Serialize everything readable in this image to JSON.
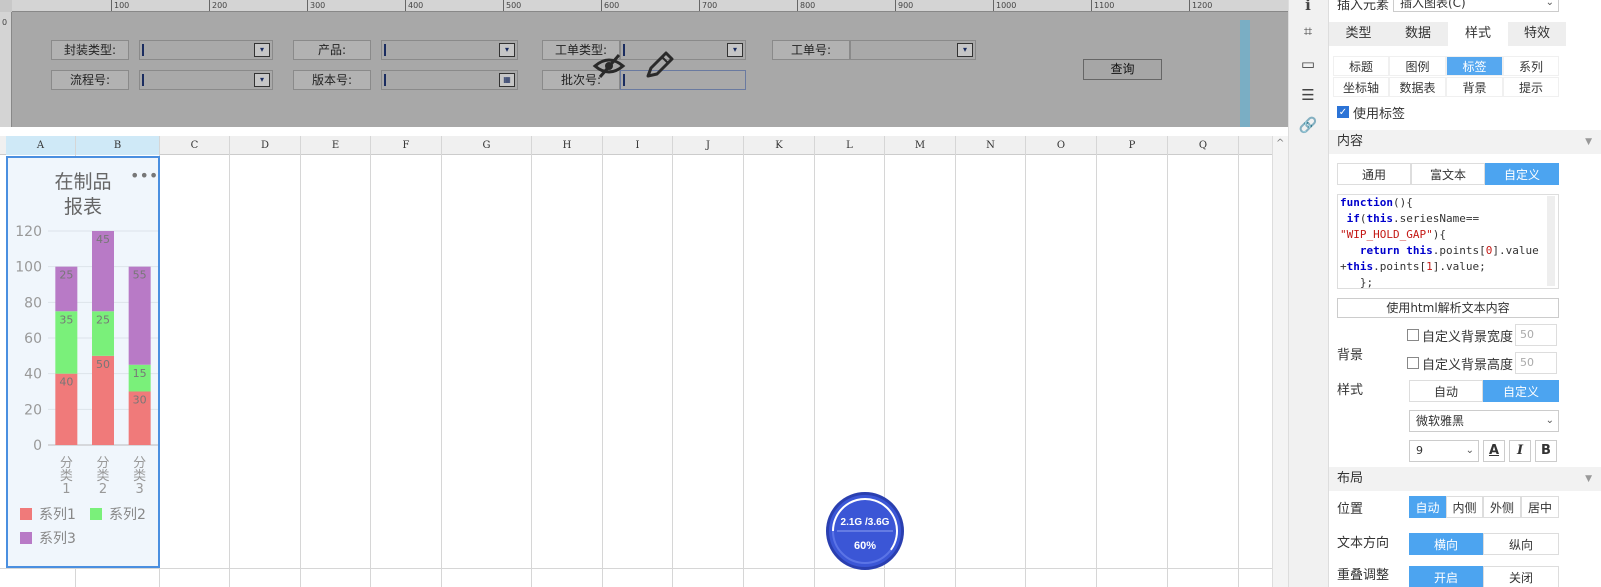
{
  "param_area": {
    "ruler_ticks": [
      "100",
      "200",
      "300",
      "400",
      "500",
      "600",
      "700",
      "800",
      "900",
      "1000",
      "1100",
      "1200"
    ],
    "left_ruler": [
      "0"
    ],
    "labels": {
      "package_type": "封装类型:",
      "product": "产品:",
      "work_order_type": "工单类型:",
      "work_order_no": "工单号:",
      "flow_no": "流程号:",
      "version_no": "版本号:",
      "batch_no": "批次号:"
    },
    "query_button": "查询",
    "dropdown_glyph": "▾",
    "date_glyph": "▦",
    "hide_icon": "👁",
    "edit_icon": "✎"
  },
  "sheet": {
    "columns": [
      "A",
      "B",
      "C",
      "D",
      "E",
      "F",
      "G",
      "H",
      "I",
      "J",
      "K",
      "L",
      "M",
      "N",
      "O",
      "P",
      "Q",
      "I"
    ],
    "selected_columns": [
      "A",
      "B"
    ]
  },
  "chart_data": {
    "type": "bar",
    "stacked": true,
    "title": "在制品报表",
    "title_lines": [
      "在制品",
      "报表"
    ],
    "categories": [
      "分类1",
      "分类2",
      "分类3"
    ],
    "category_tick_lines": [
      [
        "分",
        "类",
        "1"
      ],
      [
        "分",
        "类",
        "2"
      ],
      [
        "分",
        "类",
        "3"
      ]
    ],
    "series": [
      {
        "name": "系列1",
        "values": [
          40,
          50,
          30
        ],
        "color": "#f07a7a"
      },
      {
        "name": "系列2",
        "values": [
          35,
          25,
          15
        ],
        "color": "#7af07a"
      },
      {
        "name": "系列3",
        "values": [
          25,
          45,
          55
        ],
        "color": "#b87ac6"
      }
    ],
    "data_labels": [
      [
        "40",
        "50",
        "30"
      ],
      [
        "35",
        "25",
        "15"
      ],
      [
        "25",
        "45",
        "55"
      ]
    ],
    "ylim": [
      0,
      120
    ],
    "yticks": [
      "0",
      "20",
      "40",
      "60",
      "80",
      "100",
      "120"
    ],
    "grid": true,
    "legend_position": "bottom",
    "more_icon": "•••"
  },
  "memory": {
    "usage": "2.1G /3.6G",
    "percent": "60%",
    "fraction": 0.6
  },
  "panel": {
    "insert_label": "插入元素",
    "insert_select": "插入图表(C)",
    "tabs": [
      "类型",
      "数据",
      "样式",
      "特效"
    ],
    "active_tab": "样式",
    "subtabs_row1": [
      "标题",
      "图例",
      "标签",
      "系列"
    ],
    "subtabs_row2": [
      "坐标轴",
      "数据表",
      "背景",
      "提示"
    ],
    "active_subtab": "标签",
    "use_label": "使用标签",
    "use_label_checked": true,
    "content_section": "内容",
    "content_modes": [
      "通用",
      "富文本",
      "自定义"
    ],
    "active_content_mode": "自定义",
    "code_lines": [
      "function(){",
      " if(this.seriesName==",
      "\"WIP_HOLD_GAP\"){",
      "   return this.points[0].value",
      "+this.points[1].value;",
      "   };"
    ],
    "html_parse_button": "使用html解析文本内容",
    "background_label": "背景",
    "custom_bg_width": "自定义背景宽度",
    "custom_bg_height": "自定义背景高度",
    "bg_width_value": "50",
    "bg_height_value": "50",
    "style_label": "样式",
    "style_modes": [
      "自动",
      "自定义"
    ],
    "active_style_mode": "自定义",
    "font_name": "微软雅黑",
    "font_size": "9",
    "font_color_glyph": "A",
    "italic_glyph": "I",
    "bold_glyph": "B",
    "layout_section": "布局",
    "position_label": "位置",
    "position_modes": [
      "自动",
      "内侧",
      "外侧",
      "居中"
    ],
    "active_position_mode": "自动",
    "text_direction_label": "文本方向",
    "text_direction_modes": [
      "横向",
      "纵向"
    ],
    "active_text_direction": "横向",
    "overlap_label": "重叠调整",
    "overlap_modes": [
      "开启",
      "关闭"
    ],
    "collapse_arrow": "▼",
    "select_caret": "⌄"
  },
  "icon_strip": {
    "icons": [
      "info-icon",
      "crop-icon",
      "dropdown-widget-icon",
      "layout-icon",
      "link-icon"
    ],
    "glyphs": [
      "ℹ",
      "⌗",
      "▭",
      "☰",
      "🔗"
    ]
  }
}
